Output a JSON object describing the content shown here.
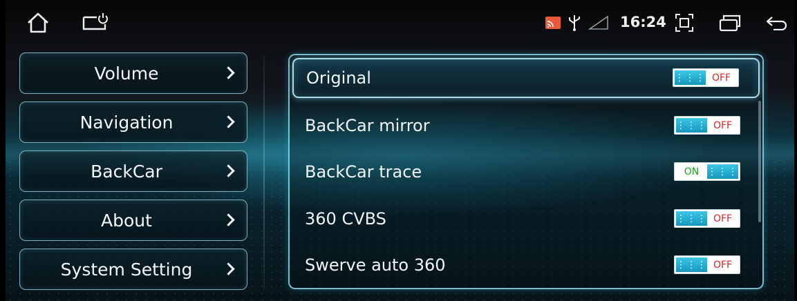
{
  "statusbar": {
    "time": "16:24",
    "icons": [
      "home-icon",
      "screen-power-icon",
      "cast-icon",
      "usb-icon",
      "signal-icon",
      "fullscreen-icon",
      "window-icon",
      "back-icon"
    ]
  },
  "menu": {
    "items": [
      {
        "label": "Volume"
      },
      {
        "label": "Navigation"
      },
      {
        "label": "BackCar"
      },
      {
        "label": "About"
      },
      {
        "label": "System Setting"
      }
    ]
  },
  "settings": {
    "rows": [
      {
        "label": "Original",
        "state": "OFF",
        "selected": true
      },
      {
        "label": "BackCar mirror",
        "state": "OFF",
        "selected": false
      },
      {
        "label": "BackCar trace",
        "state": "ON",
        "selected": false
      },
      {
        "label": "360 CVBS",
        "state": "OFF",
        "selected": false
      },
      {
        "label": "Swerve auto 360",
        "state": "OFF",
        "selected": false
      }
    ]
  },
  "colors": {
    "accent": "#1aa6cc",
    "off": "#e02020",
    "on": "#18a818"
  }
}
